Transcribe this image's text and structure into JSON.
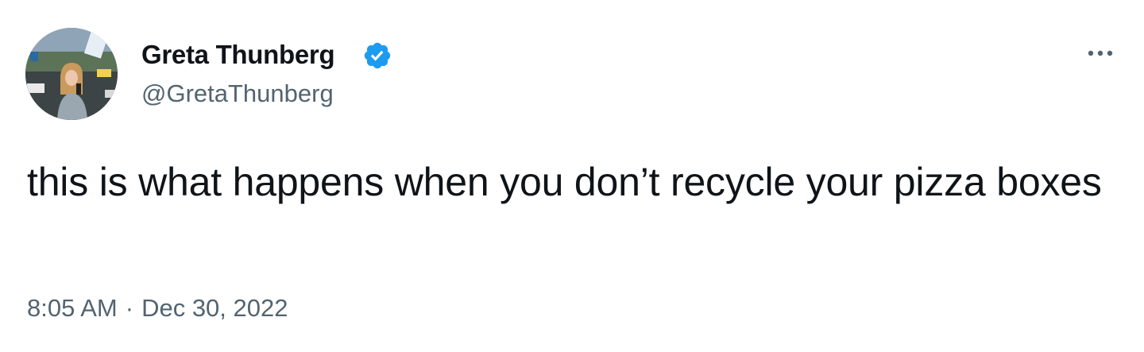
{
  "author": {
    "display_name": "Greta Thunberg",
    "handle": "@GretaThunberg",
    "verified_icon": "verified-badge-icon",
    "avatar_icon": "profile-photo"
  },
  "tweet": {
    "text": "this is what happens when you don’t recycle your pizza boxes"
  },
  "meta": {
    "time": "8:05 AM",
    "separator": "·",
    "date": "Dec 30, 2022"
  },
  "actions": {
    "more_icon": "more-options-icon"
  },
  "colors": {
    "text_primary": "#0f1419",
    "text_secondary": "#536471",
    "verified_blue": "#1d9bf0",
    "background": "#ffffff"
  }
}
